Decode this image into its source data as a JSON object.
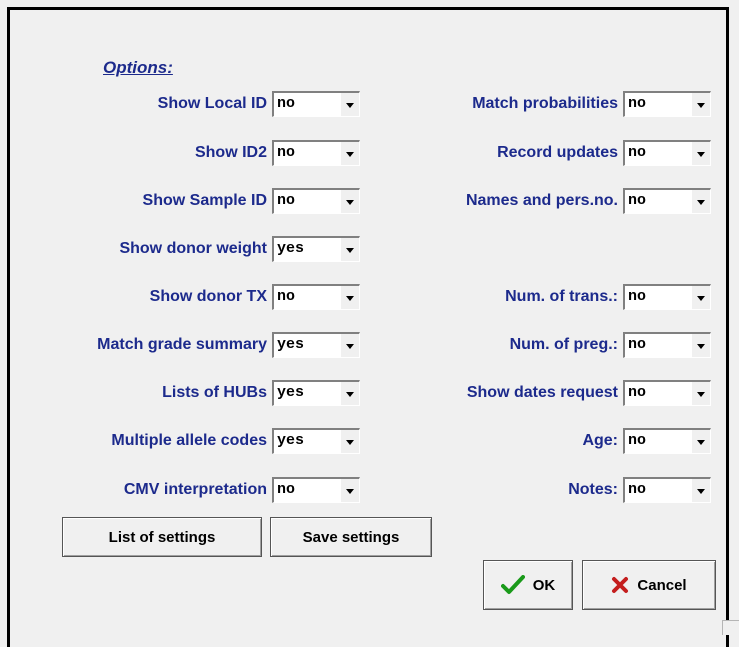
{
  "options_title": "Options:",
  "left_options": [
    {
      "label": "Show Local ID",
      "value": "no"
    },
    {
      "label": "Show ID2",
      "value": "no"
    },
    {
      "label": "Show Sample ID",
      "value": "no"
    },
    {
      "label": "Show donor weight",
      "value": "yes"
    },
    {
      "label": "Show donor TX",
      "value": "no"
    },
    {
      "label": "Match grade summary",
      "value": "yes"
    },
    {
      "label": "Lists of HUBs",
      "value": "yes"
    },
    {
      "label": "Multiple allele codes",
      "value": "yes"
    },
    {
      "label": "CMV interpretation",
      "value": "no"
    }
  ],
  "right_options": [
    {
      "label": "Match probabilities",
      "value": "no"
    },
    {
      "label": "Record updates",
      "value": "no"
    },
    {
      "label": "Names and pers.no.",
      "value": "no"
    },
    {
      "label": "Num. of trans.:",
      "value": "no"
    },
    {
      "label": "Num. of preg.:",
      "value": "no"
    },
    {
      "label": "Show dates request",
      "value": "no"
    },
    {
      "label": "Age:",
      "value": "no"
    },
    {
      "label": "Notes:",
      "value": "no"
    }
  ],
  "buttons": {
    "list_settings": "List of settings",
    "save_settings": "Save settings",
    "ok": "OK",
    "cancel": "Cancel"
  },
  "icons": {
    "ok": "checkmark-icon",
    "cancel": "x-icon",
    "dropdown": "chevron-down-icon"
  },
  "colors": {
    "label": "#1c2a8c",
    "ok_icon": "#1a9a1a",
    "cancel_icon": "#c41e1e"
  }
}
